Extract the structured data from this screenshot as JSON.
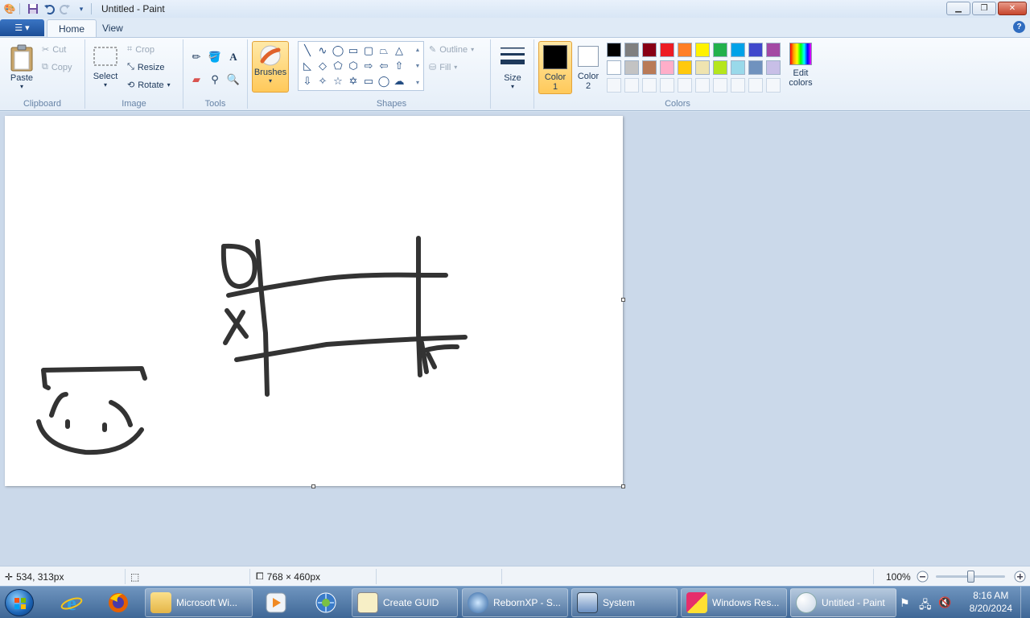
{
  "window": {
    "title": "Untitled - Paint"
  },
  "tabs": {
    "home": "Home",
    "view": "View"
  },
  "clipboard": {
    "paste": "Paste",
    "cut": "Cut",
    "copy": "Copy",
    "label": "Clipboard"
  },
  "image": {
    "select": "Select",
    "crop": "Crop",
    "resize": "Resize",
    "rotate": "Rotate",
    "label": "Image"
  },
  "tools": {
    "label": "Tools"
  },
  "brushes": {
    "label": "Brushes"
  },
  "shapes": {
    "outline": "Outline",
    "fill": "Fill",
    "label": "Shapes"
  },
  "size": {
    "label": "Size"
  },
  "colors": {
    "color1_line1": "Color",
    "color1_line2": "1",
    "color2_line1": "Color",
    "color2_line2": "2",
    "edit_line1": "Edit",
    "edit_line2": "colors",
    "label": "Colors",
    "color1_value": "#000000",
    "color2_value": "#ffffff",
    "palette_row1": [
      "#000000",
      "#7f7f7f",
      "#880015",
      "#ed1c24",
      "#ff7f27",
      "#fff200",
      "#22b14c",
      "#00a2e8",
      "#3f48cc",
      "#a349a4"
    ],
    "palette_row2": [
      "#ffffff",
      "#c3c3c3",
      "#b97a57",
      "#ffaec9",
      "#ffc90e",
      "#efe4b0",
      "#b5e61d",
      "#99d9ea",
      "#7092be",
      "#c8bfe7"
    ]
  },
  "status": {
    "cursor": "534, 313px",
    "canvas_size": "768 × 460px",
    "zoom": "100%",
    "zoom_level": 0.5
  },
  "taskbar": {
    "items": [
      "Microsoft Wi...",
      "Create GUID",
      "RebornXP - S...",
      "System",
      "Windows Res...",
      "Untitled - Paint"
    ],
    "time": "8:16 AM",
    "date": "8/20/2024"
  }
}
